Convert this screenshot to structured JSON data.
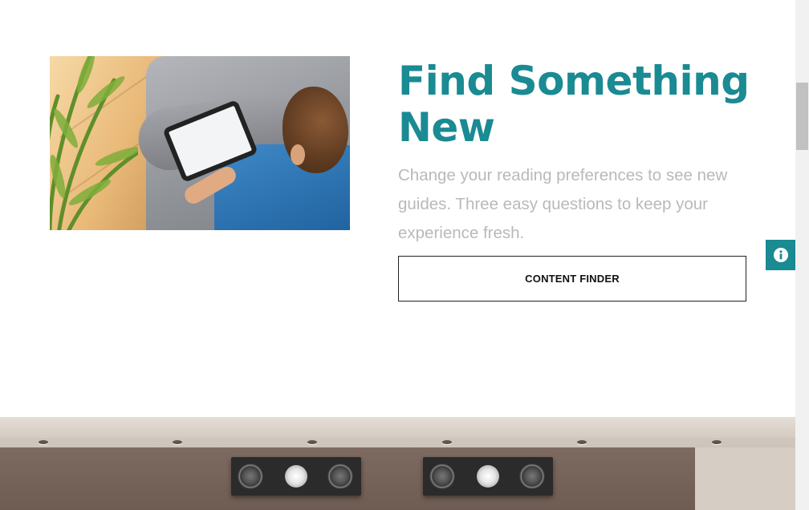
{
  "hero": {
    "heading": "Find Something New",
    "description": "Change your reading preferences to see new guides. Three easy questions to keep your experience fresh.",
    "button_label": "CONTENT FINDER"
  },
  "colors": {
    "accent": "#1a8a93",
    "description_text": "#b9b9b9"
  },
  "icons": {
    "info_tab": "info-icon"
  }
}
